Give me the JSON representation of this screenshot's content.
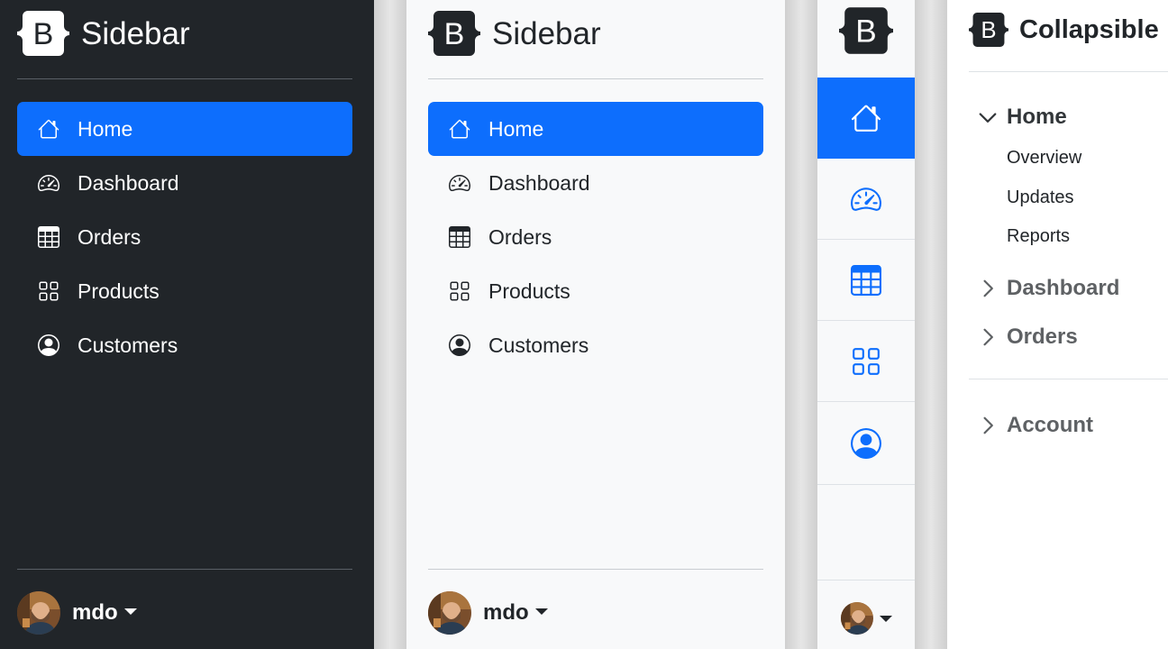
{
  "dark_sidebar": {
    "brand_letter": "B",
    "brand_title": "Sidebar",
    "nav": [
      {
        "label": "Home",
        "icon": "home-icon",
        "active": true
      },
      {
        "label": "Dashboard",
        "icon": "speedometer-icon",
        "active": false
      },
      {
        "label": "Orders",
        "icon": "table-icon",
        "active": false
      },
      {
        "label": "Products",
        "icon": "grid-icon",
        "active": false
      },
      {
        "label": "Customers",
        "icon": "person-circle-icon",
        "active": false
      }
    ],
    "user": "mdo"
  },
  "light_sidebar": {
    "brand_letter": "B",
    "brand_title": "Sidebar",
    "nav": [
      {
        "label": "Home",
        "icon": "home-icon",
        "active": true
      },
      {
        "label": "Dashboard",
        "icon": "speedometer-icon",
        "active": false
      },
      {
        "label": "Orders",
        "icon": "table-icon",
        "active": false
      },
      {
        "label": "Products",
        "icon": "grid-icon",
        "active": false
      },
      {
        "label": "Customers",
        "icon": "person-circle-icon",
        "active": false
      }
    ],
    "user": "mdo"
  },
  "icon_sidebar": {
    "brand_letter": "B",
    "items": [
      "home-icon",
      "speedometer-icon",
      "table-icon",
      "grid-icon",
      "person-circle-icon"
    ],
    "active_index": 0
  },
  "collapsible_sidebar": {
    "brand_letter": "B",
    "brand_title": "Collapsible",
    "sections": [
      {
        "label": "Home",
        "expanded": true,
        "children": [
          "Overview",
          "Updates",
          "Reports"
        ]
      },
      {
        "label": "Dashboard",
        "expanded": false
      },
      {
        "label": "Orders",
        "expanded": false
      }
    ],
    "account": {
      "label": "Account",
      "expanded": false
    }
  },
  "colors": {
    "primary": "#0d6efd",
    "dark_bg": "#212529",
    "light_bg": "#f8f9fa"
  }
}
